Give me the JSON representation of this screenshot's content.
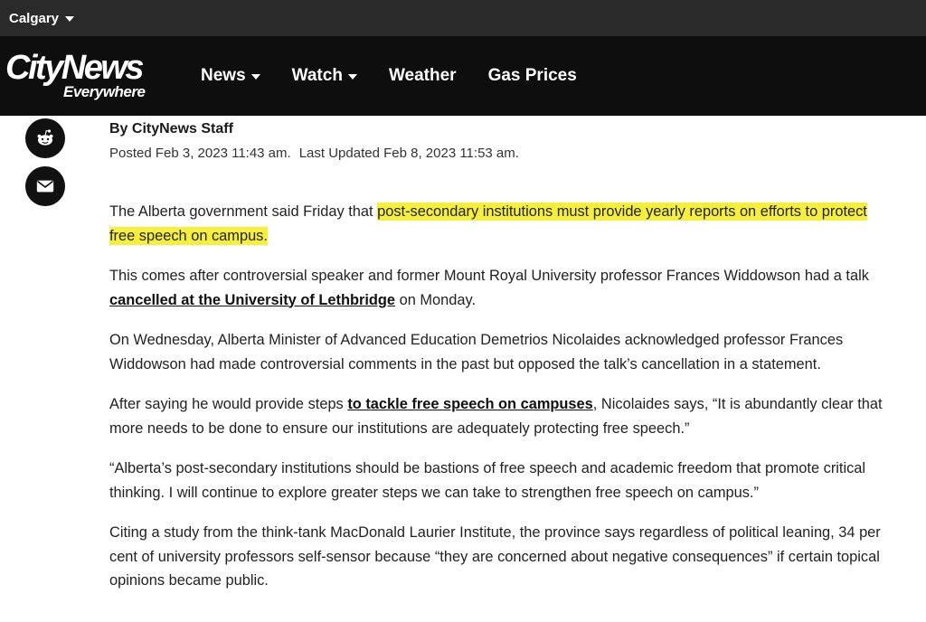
{
  "topbar": {
    "city": "Calgary"
  },
  "header": {
    "logo_main": "CityNews",
    "logo_sub": "Everywhere",
    "nav": [
      {
        "label": "News",
        "has_dropdown": true
      },
      {
        "label": "Watch",
        "has_dropdown": true
      },
      {
        "label": "Weather",
        "has_dropdown": false
      },
      {
        "label": "Gas Prices",
        "has_dropdown": false
      }
    ]
  },
  "share": {
    "icons": [
      "reddit-icon",
      "email-icon"
    ]
  },
  "article": {
    "byline": "By CityNews Staff",
    "posted": "Posted Feb 3, 2023 11:43 am.",
    "updated": "Last Updated Feb 8, 2023 11:53 am.",
    "p1_before": "The Alberta government said Friday that ",
    "p1_highlight": "post-secondary institutions must provide yearly reports on efforts to protect free speech on campus.",
    "p2_before": "This comes after controversial speaker and former Mount Royal University professor Frances Widdowson had a talk ",
    "p2_link": "cancelled at the University of Lethbridge",
    "p2_after": " on Monday.",
    "p3": "On Wednesday, Alberta Minister of Advanced Education Demetrios Nicolaides acknowledged professor Frances Widdowson had made controversial comments in the past but opposed the talk’s cancellation in a statement.",
    "p4_before": "After saying he would provide steps ",
    "p4_link": "to tackle free speech on campuses",
    "p4_after": ", Nicolaides says, “It is abundantly clear that more needs to be done to ensure our institutions are adequately protecting free speech.”",
    "p5": "“Alberta’s post-secondary institutions should be bastions of free speech and academic freedom that promote critical thinking. I will continue to explore greater steps we can take to strengthen free speech on campus.”",
    "p6": "Citing a study from the think-tank MacDonald Laurier Institute, the province says regardless of political leaning, 34 per cent of university professors self-sensor because “they are concerned about negative consequences” if certain topical opinions became public."
  },
  "colors": {
    "topbar_bg": "#2a2a2a",
    "nav_bg": "#0e0e0e",
    "highlight": "#f6f03a",
    "text": "#222222"
  }
}
